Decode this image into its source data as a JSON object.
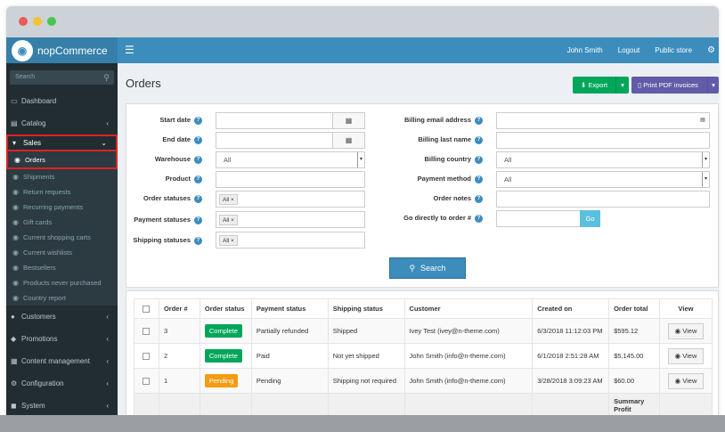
{
  "window": {
    "colors": {
      "close": "#ec5b56",
      "minimize": "#f5c330",
      "maximize": "#48c651"
    }
  },
  "topbar": {
    "brand": "nopCommerce",
    "user": "John Smith",
    "logout": "Logout",
    "public_store": "Public store"
  },
  "sidebar": {
    "search_placeholder": "Search",
    "dashboard": "Dashboard",
    "catalog": "Catalog",
    "sales": "Sales",
    "sales_items": [
      "Orders",
      "Shipments",
      "Return requests",
      "Recurring payments",
      "Gift cards",
      "Current shopping carts",
      "Current wishlists",
      "Bestsellers",
      "Products never purchased",
      "Country report"
    ],
    "customers": "Customers",
    "promotions": "Promotions",
    "content_management": "Content management",
    "configuration": "Configuration",
    "system": "System"
  },
  "page": {
    "title": "Orders",
    "export": "Export",
    "print_pdf": "Print PDF invoices"
  },
  "filters": {
    "start_date": "Start date",
    "end_date": "End date",
    "warehouse": "Warehouse",
    "warehouse_value": "All",
    "product": "Product",
    "order_statuses": "Order statuses",
    "order_statuses_value": "All",
    "payment_statuses": "Payment statuses",
    "payment_statuses_value": "All",
    "shipping_statuses": "Shipping statuses",
    "shipping_statuses_value": "All",
    "billing_email": "Billing email address",
    "billing_last_name": "Billing last name",
    "billing_country": "Billing country",
    "billing_country_value": "All",
    "payment_method": "Payment method",
    "payment_method_value": "All",
    "order_notes": "Order notes",
    "go_to_order": "Go directly to order #",
    "go": "Go",
    "search": "Search"
  },
  "table": {
    "headers": [
      "Order #",
      "Order status",
      "Payment status",
      "Shipping status",
      "Customer",
      "Created on",
      "Order total",
      "View"
    ],
    "view_label": "View",
    "rows": [
      {
        "order": "3",
        "status": "Complete",
        "status_color": "#00a65a",
        "payment": "Partially refunded",
        "shipping": "Shipped",
        "customer": "Ivey Test (ivey@n-theme.com)",
        "created": "6/3/2018 11:12:03 PM",
        "total": "$595.12"
      },
      {
        "order": "2",
        "status": "Complete",
        "status_color": "#00a65a",
        "payment": "Paid",
        "shipping": "Not yet shipped",
        "customer": "John Smith (info@n-theme.com)",
        "created": "6/1/2018 2:51:28 AM",
        "total": "$5,145.00"
      },
      {
        "order": "1",
        "status": "Pending",
        "status_color": "#f39c12",
        "payment": "Pending",
        "shipping": "Shipping not required",
        "customer": "John Smith (info@n-theme.com)",
        "created": "3/28/2018 3:09:23 AM",
        "total": "$60.00"
      }
    ],
    "summary_label": "Summary Profit"
  }
}
